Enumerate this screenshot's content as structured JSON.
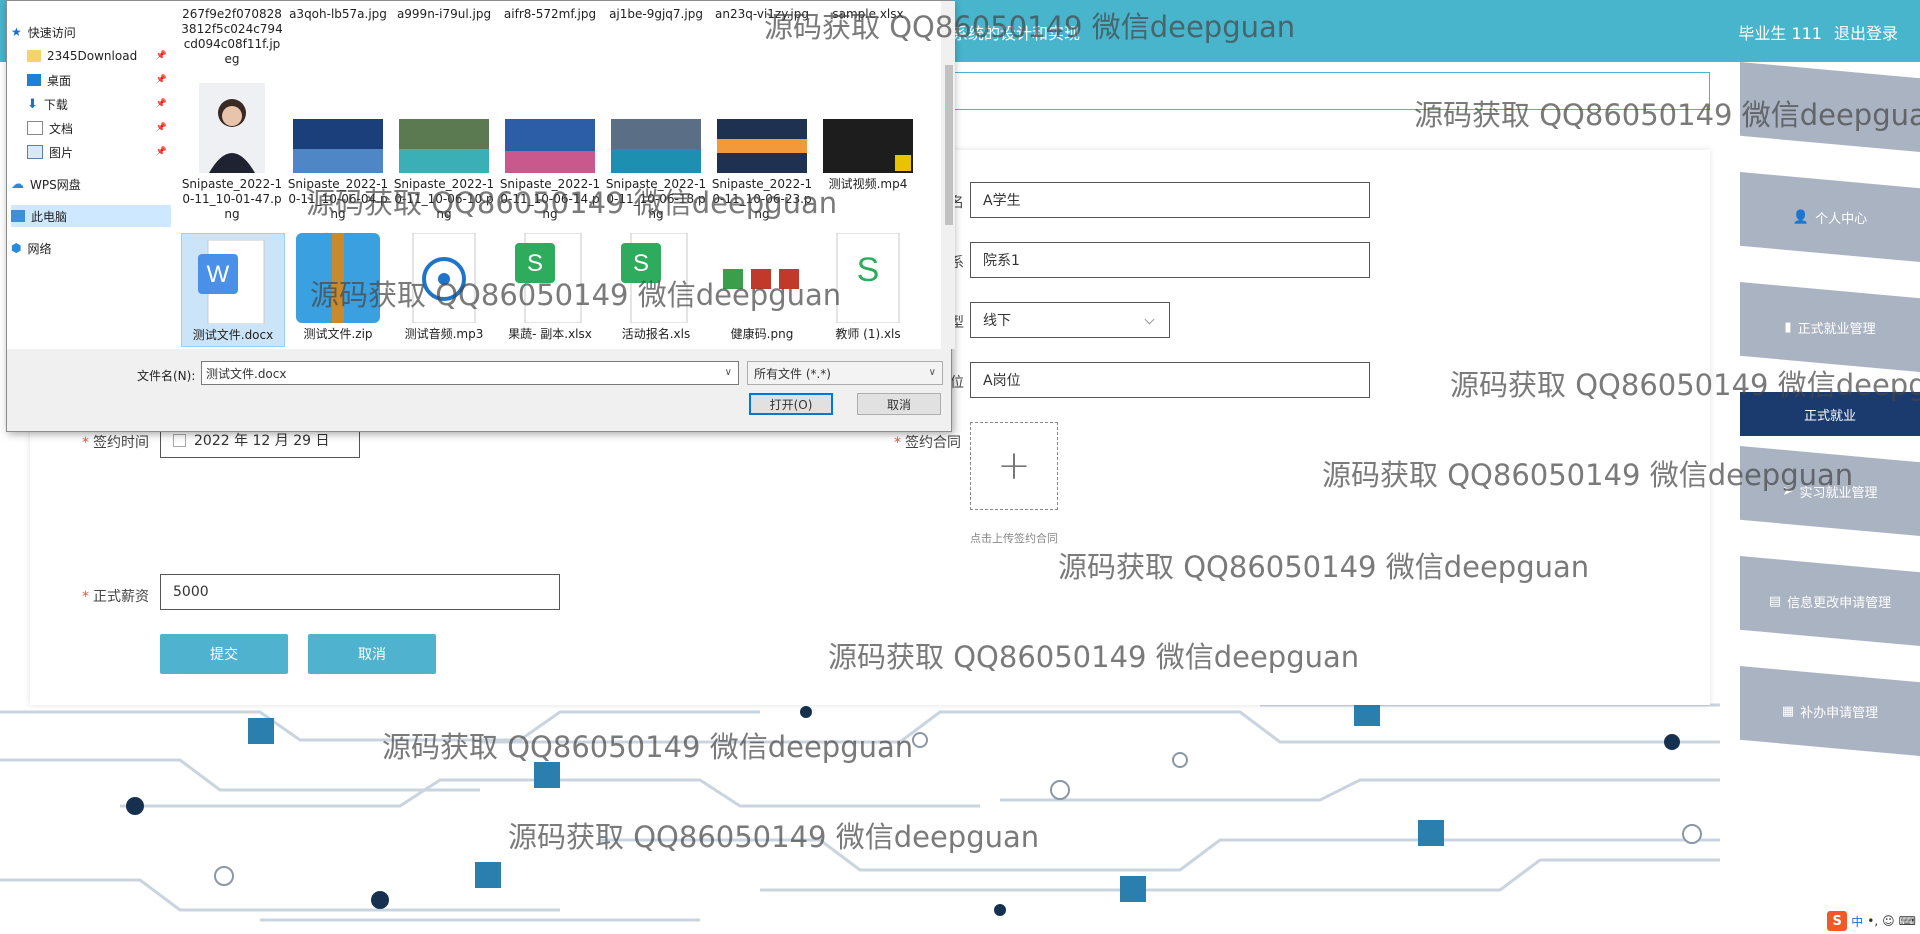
{
  "header": {
    "title": "管理系统的设计和实现",
    "user": "毕业生 111",
    "logout": "退出登录"
  },
  "sidebar": {
    "items": [
      {
        "label": "个人中心",
        "icon": "user-icon"
      },
      {
        "label": "正式就业管理",
        "icon": "bookmark-icon"
      },
      {
        "label": "正式就业",
        "icon": ""
      },
      {
        "label": "实习就业管理",
        "icon": "send-icon"
      },
      {
        "label": "信息更改申请管理",
        "icon": "clipboard-icon"
      },
      {
        "label": "补办申请管理",
        "icon": "grid-icon"
      }
    ]
  },
  "form": {
    "name_label_tail": "名",
    "name_value": "A学生",
    "dept_label_tail": "系",
    "dept_value": "院系1",
    "type_label_tail": "型",
    "type_value": "线下",
    "position_label_tail": "位",
    "position_value": "A岗位",
    "sign_time_label": "签约时间",
    "sign_time_value": "2022 年 12 月 29 日",
    "contract_label": "签约合同",
    "upload_plus": "+",
    "upload_hint": "点击上传签约合同",
    "salary_label": "正式薪资",
    "salary_value": "5000",
    "submit": "提交",
    "cancel": "取消",
    "required_mark": "*"
  },
  "dialog": {
    "nav": [
      {
        "label": "快速访问",
        "icon": "star-icon"
      },
      {
        "label": "2345Download",
        "icon": "folder-icon",
        "pin": "📌"
      },
      {
        "label": "桌面",
        "icon": "desktop-icon",
        "pin": "📌"
      },
      {
        "label": "下载",
        "icon": "download-icon",
        "pin": "📌"
      },
      {
        "label": "文档",
        "icon": "document-icon",
        "pin": "📌"
      },
      {
        "label": "图片",
        "icon": "picture-icon",
        "pin": "📌"
      },
      {
        "label": "WPS网盘",
        "icon": "cloud-icon"
      },
      {
        "label": "此电脑",
        "icon": "computer-icon"
      },
      {
        "label": "网络",
        "icon": "network-icon"
      }
    ],
    "row1": [
      "267f9e2f0708283812f5c024c794cd094c08f11f.jpeg",
      "a3qoh-lb57a.jpg",
      "a999n-i79ul.jpg",
      "aifr8-572mf.jpg",
      "aj1be-9gjq7.jpg",
      "an23q-vi1zy.jpg",
      "sample.xlsx"
    ],
    "row2": [
      "Snipaste_2022-10-11_10-01-47.png",
      "Snipaste_2022-10-11_10-06-04.png",
      "Snipaste_2022-10-11_10-06-10.png",
      "Snipaste_2022-10-11_10-06-14.png",
      "Snipaste_2022-10-11_10-06-18.png",
      "Snipaste_2022-10-11_10-06-23.png",
      "测试视频.mp4"
    ],
    "row3": [
      "测试文件.docx",
      "测试文件.zip",
      "测试音频.mp3",
      "果蔬- 副本.xlsx",
      "活动报名.xls",
      "健康码.png",
      "教师 (1).xls"
    ],
    "filename_label": "文件名(N):",
    "filename_value": "测试文件.docx",
    "filter_value": "所有文件 (*.*)",
    "open_button": "打开(O)",
    "cancel_button": "取消",
    "dropdown_glyph": "∨"
  },
  "watermark": "源码获取 QQ86050149 微信deepguan",
  "tray": {
    "ime": "中",
    "punct": "•,",
    "logo": "S"
  },
  "colors": {
    "header": "#48b5cc",
    "sidebar": "#aab3c2",
    "sidebar_active": "#1b3a6e",
    "button": "#4fb3cf"
  }
}
